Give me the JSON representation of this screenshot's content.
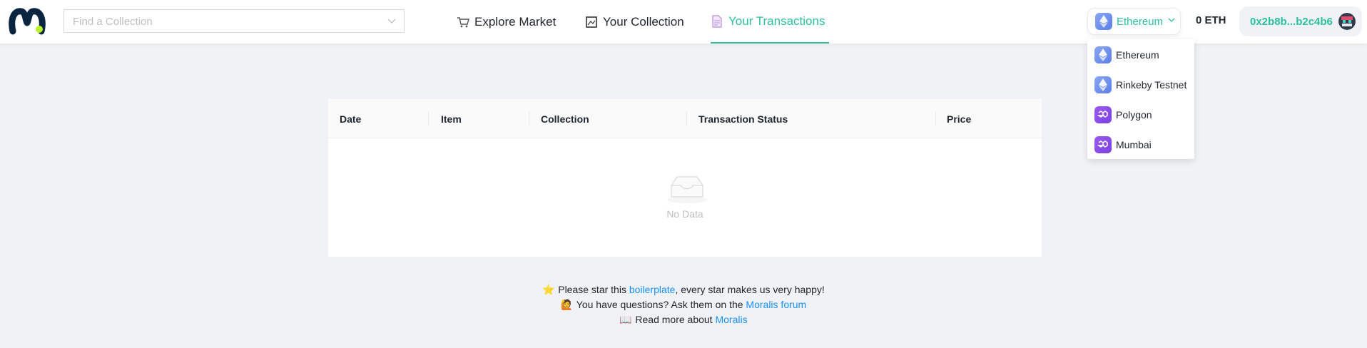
{
  "header": {
    "search": {
      "placeholder": "Find a Collection"
    },
    "nav": [
      {
        "label": "Explore Market",
        "icon": "cart-icon"
      },
      {
        "label": "Your Collection",
        "icon": "frame-icon"
      },
      {
        "label": "Your Transactions",
        "icon": "document-icon",
        "active": true
      }
    ],
    "network": {
      "selected": "Ethereum"
    },
    "balance": "0 ETH",
    "address": "0x2b8b...b2c4b6"
  },
  "network_dropdown": {
    "options": [
      {
        "label": "Ethereum",
        "icon": "ethereum-icon"
      },
      {
        "label": "Rinkeby Testnet",
        "icon": "ethereum-icon"
      },
      {
        "label": "Polygon",
        "icon": "polygon-icon"
      },
      {
        "label": "Mumbai",
        "icon": "polygon-icon"
      }
    ]
  },
  "table": {
    "columns": [
      "Date",
      "Item",
      "Collection",
      "Transaction Status",
      "Price"
    ],
    "empty_text": "No Data"
  },
  "footer": {
    "line1": {
      "emoji": "⭐",
      "pre": "Please star this ",
      "link": "boilerplate",
      "post": ", every star makes us very happy!"
    },
    "line2": {
      "emoji": "🙋",
      "pre": "You have questions? Ask them on the ",
      "link": "Moralis forum",
      "post": ""
    },
    "line3": {
      "emoji": "📖",
      "pre": "Read more about ",
      "link": "Moralis",
      "post": ""
    }
  },
  "colors": {
    "accent": "#2bbfa0",
    "link": "#1890ff",
    "background": "#f0f2f5"
  }
}
